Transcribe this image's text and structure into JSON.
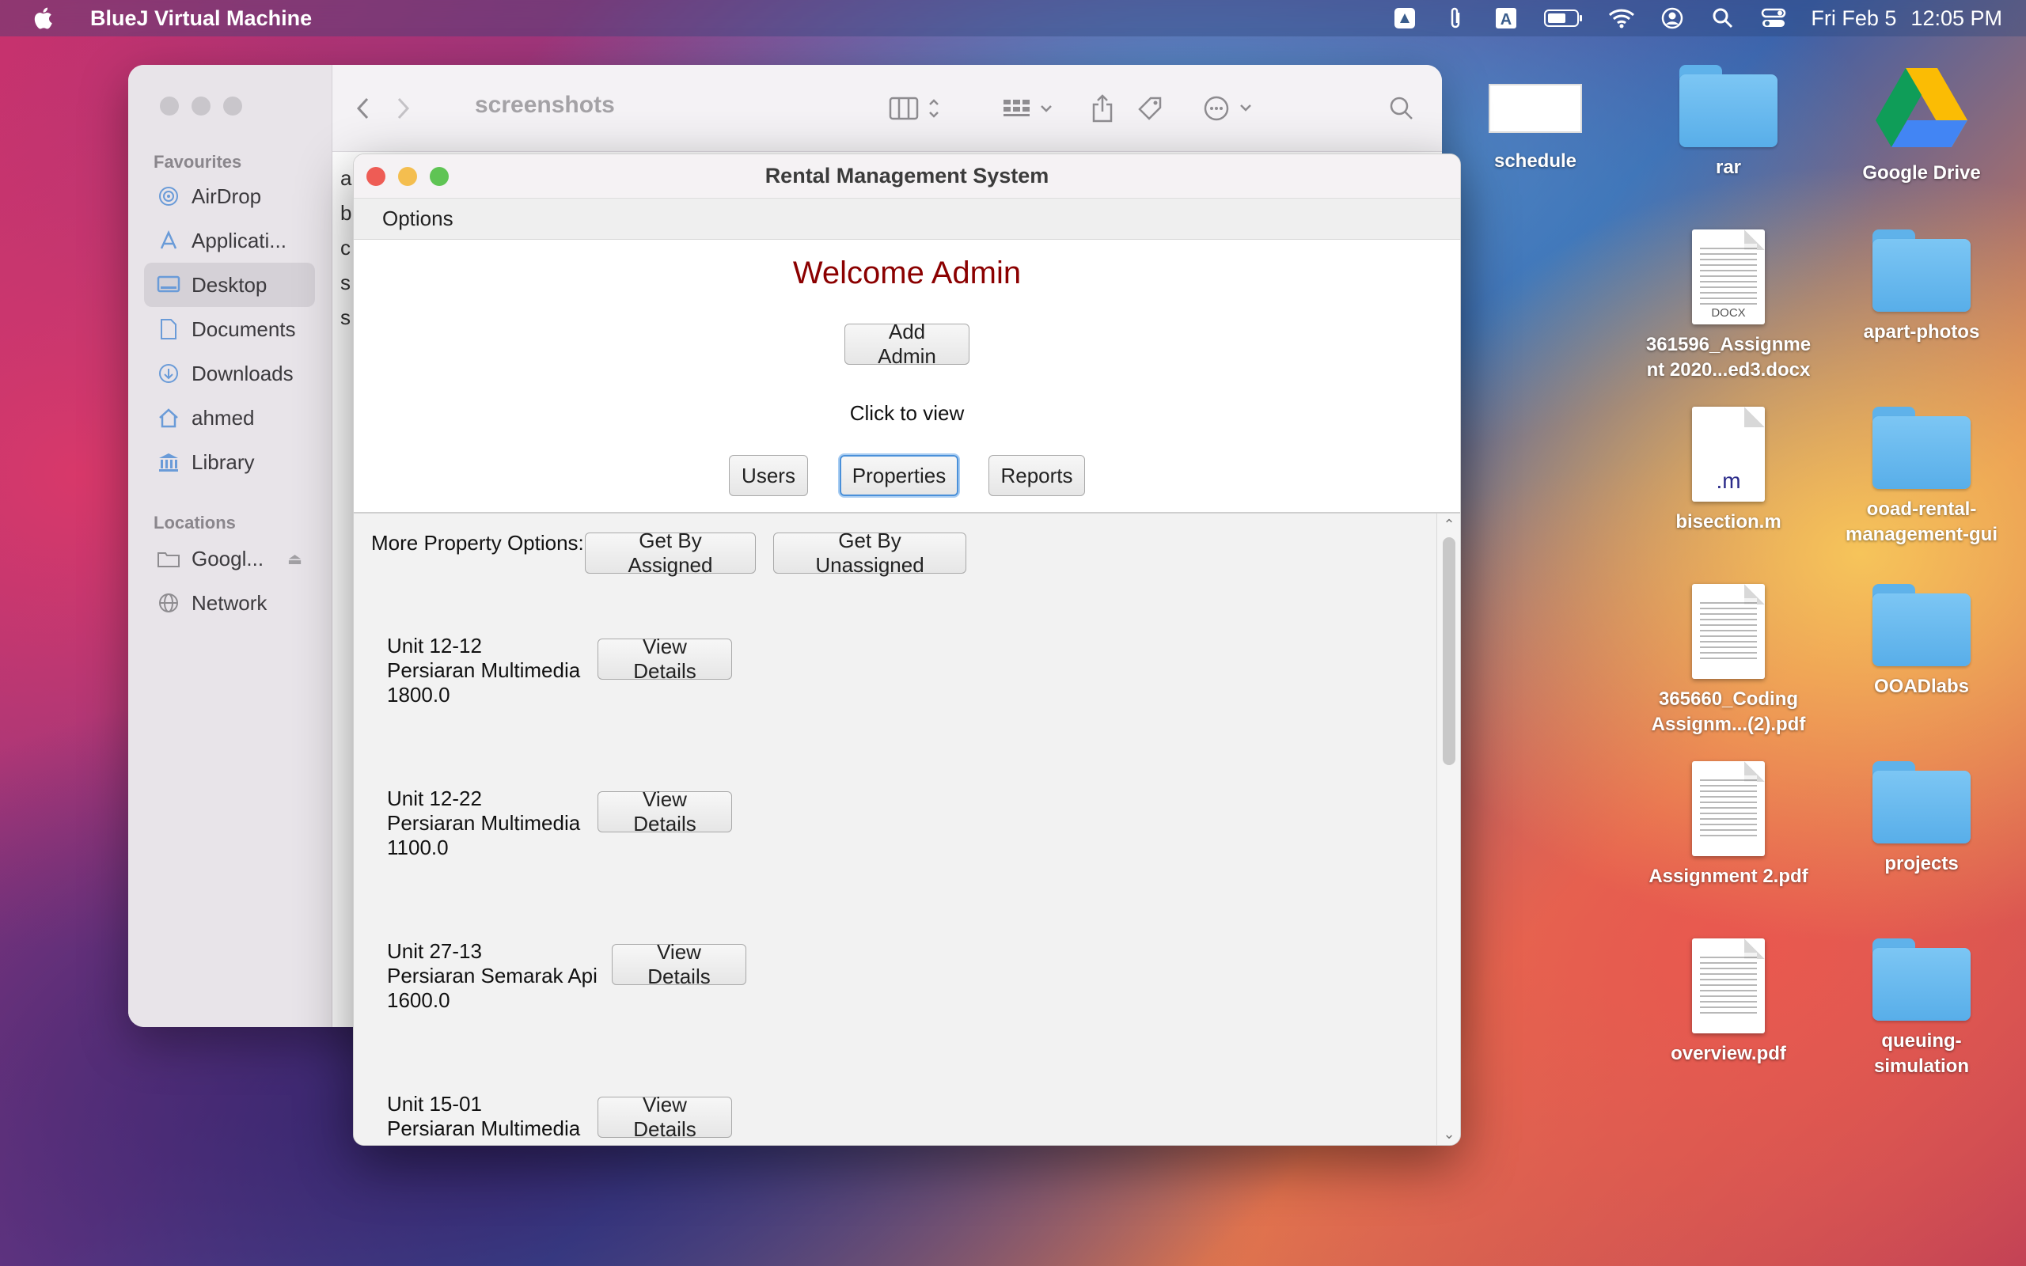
{
  "menubar": {
    "app_name": "BlueJ Virtual Machine",
    "date": "Fri Feb 5",
    "time": "12:05 PM",
    "icons": [
      "apple-logo-icon",
      "google-drive-status-icon",
      "paperclip-icon",
      "text-input-a-icon",
      "battery-icon",
      "wifi-icon",
      "user-account-icon",
      "spotlight-search-icon",
      "control-center-icon"
    ]
  },
  "finder": {
    "title": "screenshots",
    "sidebar": {
      "favourites_label": "Favourites",
      "favourites": [
        {
          "label": "AirDrop",
          "icon": "airdrop-icon"
        },
        {
          "label": "Applicati...",
          "icon": "applications-icon"
        },
        {
          "label": "Desktop",
          "icon": "desktop-icon",
          "selected": true
        },
        {
          "label": "Documents",
          "icon": "document-icon"
        },
        {
          "label": "Downloads",
          "icon": "downloads-icon"
        },
        {
          "label": "ahmed",
          "icon": "home-icon"
        },
        {
          "label": "Library",
          "icon": "library-icon"
        }
      ],
      "locations_label": "Locations",
      "locations": [
        {
          "label": "Googl...",
          "icon": "drive-icon"
        },
        {
          "label": "Network",
          "icon": "network-icon"
        }
      ]
    },
    "content_rows": [
      "a",
      "b",
      "c",
      "s",
      "s"
    ]
  },
  "app": {
    "title": "Rental Management System",
    "menu": "Options",
    "welcome": "Welcome Admin",
    "add_admin": "Add Admin",
    "click_to_view": "Click to view",
    "tabs": {
      "users": "Users",
      "properties": "Properties",
      "reports": "Reports"
    },
    "more_options_label": "More Property Options:",
    "get_assigned": "Get By Assigned",
    "get_unassigned": "Get By Unassigned",
    "view_details": "View Details",
    "properties": [
      {
        "unit": "Unit 12-12",
        "street": "Persiaran Multimedia",
        "price": "1800.0"
      },
      {
        "unit": "Unit 12-22",
        "street": "Persiaran Multimedia",
        "price": "1100.0"
      },
      {
        "unit": "Unit 27-13",
        "street": "Persiaran Semarak Api",
        "price": "1600.0"
      },
      {
        "unit": "Unit 15-01",
        "street": "Persiaran Multimedia",
        "price": ""
      }
    ]
  },
  "desktop": [
    {
      "label_1": "schedule",
      "label_2": "",
      "kind": "image"
    },
    {
      "label_1": "rar",
      "label_2": "",
      "kind": "folder"
    },
    {
      "label_1": "Google Drive",
      "label_2": "",
      "kind": "gdrive"
    },
    {
      "label_1": "361596_Assignme",
      "label_2": "nt 2020...ed3.docx",
      "kind": "docx",
      "ext": "DOCX"
    },
    {
      "label_1": "apart-photos",
      "label_2": "",
      "kind": "folder"
    },
    {
      "label_1": "bisection.m",
      "label_2": "",
      "kind": "m",
      "ext": ".m"
    },
    {
      "label_1": "ooad-rental-",
      "label_2": "management-gui",
      "kind": "folder"
    },
    {
      "label_1": "365660_Coding",
      "label_2": "Assignm...(2).pdf",
      "kind": "pdf"
    },
    {
      "label_1": "OOADlabs",
      "label_2": "",
      "kind": "folder"
    },
    {
      "label_1": "Assignment 2.pdf",
      "label_2": "",
      "kind": "pdf"
    },
    {
      "label_1": "projects",
      "label_2": "",
      "kind": "folder"
    },
    {
      "label_1": "overview.pdf",
      "label_2": "",
      "kind": "pdf"
    },
    {
      "label_1": "queuing-",
      "label_2": "simulation",
      "kind": "folder"
    }
  ]
}
